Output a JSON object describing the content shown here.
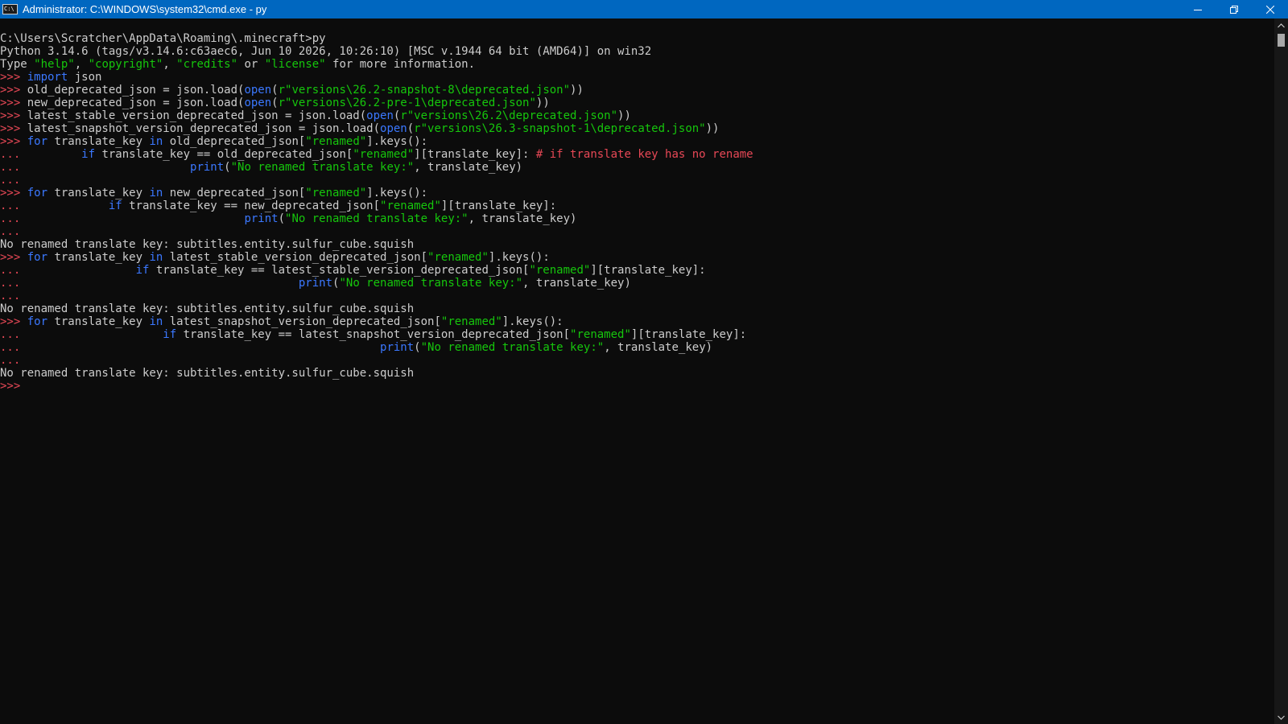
{
  "window": {
    "icon_text": "C:\\",
    "title": "Administrator: C:\\WINDOWS\\system32\\cmd.exe - py",
    "colors": {
      "titlebar": "#0067c0",
      "console_bg": "#0c0c0c",
      "default_text": "#cccccc",
      "prompt": "#e74856",
      "keyword": "#3b78ff",
      "string": "#16c60c",
      "comment": "#e74856"
    },
    "controls": [
      {
        "name": "minimize-button",
        "icon": "minimize-icon"
      },
      {
        "name": "restore-button",
        "icon": "restore-icon"
      },
      {
        "name": "close-button",
        "icon": "close-icon"
      }
    ]
  },
  "console": {
    "lines": [
      [
        {
          "t": "default",
          "s": "C:\\Users\\Scratcher\\AppData\\Roaming\\.minecraft>py"
        }
      ],
      [
        {
          "t": "default",
          "s": "Python 3.14.6 (tags/v3.14.6:c63aec6, Jun 10 2026, 10:26:10) [MSC v.1944 64 bit (AMD64)] on win32"
        }
      ],
      [
        {
          "t": "default",
          "s": "Type "
        },
        {
          "t": "string",
          "s": "\"help\""
        },
        {
          "t": "default",
          "s": ", "
        },
        {
          "t": "string",
          "s": "\"copyright\""
        },
        {
          "t": "default",
          "s": ", "
        },
        {
          "t": "string",
          "s": "\"credits\""
        },
        {
          "t": "default",
          "s": " or "
        },
        {
          "t": "string",
          "s": "\"license\""
        },
        {
          "t": "default",
          "s": " for more information."
        }
      ],
      [
        {
          "t": "prompt",
          "s": ">>> "
        },
        {
          "t": "keyword",
          "s": "import"
        },
        {
          "t": "default",
          "s": " json"
        }
      ],
      [
        {
          "t": "prompt",
          "s": ">>> "
        },
        {
          "t": "default",
          "s": "old_deprecated_json = json.load("
        },
        {
          "t": "keyword",
          "s": "open"
        },
        {
          "t": "default",
          "s": "("
        },
        {
          "t": "string",
          "s": "r\"versions\\26.2-snapshot-8\\deprecated.json\""
        },
        {
          "t": "default",
          "s": "))"
        }
      ],
      [
        {
          "t": "prompt",
          "s": ">>> "
        },
        {
          "t": "default",
          "s": "new_deprecated_json = json.load("
        },
        {
          "t": "keyword",
          "s": "open"
        },
        {
          "t": "default",
          "s": "("
        },
        {
          "t": "string",
          "s": "r\"versions\\26.2-pre-1\\deprecated.json\""
        },
        {
          "t": "default",
          "s": "))"
        }
      ],
      [
        {
          "t": "prompt",
          "s": ">>> "
        },
        {
          "t": "default",
          "s": "latest_stable_version_deprecated_json = json.load("
        },
        {
          "t": "keyword",
          "s": "open"
        },
        {
          "t": "default",
          "s": "("
        },
        {
          "t": "string",
          "s": "r\"versions\\26.2\\deprecated.json\""
        },
        {
          "t": "default",
          "s": "))"
        }
      ],
      [
        {
          "t": "prompt",
          "s": ">>> "
        },
        {
          "t": "default",
          "s": "latest_snapshot_version_deprecated_json = json.load("
        },
        {
          "t": "keyword",
          "s": "open"
        },
        {
          "t": "default",
          "s": "("
        },
        {
          "t": "string",
          "s": "r\"versions\\26.3-snapshot-1\\deprecated.json\""
        },
        {
          "t": "default",
          "s": "))"
        }
      ],
      [
        {
          "t": "prompt",
          "s": ">>> "
        },
        {
          "t": "keyword",
          "s": "for"
        },
        {
          "t": "default",
          "s": " translate_key "
        },
        {
          "t": "keyword",
          "s": "in"
        },
        {
          "t": "default",
          "s": " old_deprecated_json["
        },
        {
          "t": "string",
          "s": "\"renamed\""
        },
        {
          "t": "default",
          "s": "].keys():"
        }
      ],
      [
        {
          "t": "cont",
          "s": "...         "
        },
        {
          "t": "keyword",
          "s": "if"
        },
        {
          "t": "default",
          "s": " translate_key == old_deprecated_json["
        },
        {
          "t": "string",
          "s": "\"renamed\""
        },
        {
          "t": "default",
          "s": "][translate_key]: "
        },
        {
          "t": "comment",
          "s": "# if translate key has no rename"
        }
      ],
      [
        {
          "t": "cont",
          "s": "...                         "
        },
        {
          "t": "keyword",
          "s": "print"
        },
        {
          "t": "default",
          "s": "("
        },
        {
          "t": "string",
          "s": "\"No renamed translate key:\""
        },
        {
          "t": "default",
          "s": ", translate_key)"
        }
      ],
      [
        {
          "t": "cont",
          "s": "..."
        }
      ],
      [
        {
          "t": "prompt",
          "s": ">>> "
        },
        {
          "t": "keyword",
          "s": "for"
        },
        {
          "t": "default",
          "s": " translate_key "
        },
        {
          "t": "keyword",
          "s": "in"
        },
        {
          "t": "default",
          "s": " new_deprecated_json["
        },
        {
          "t": "string",
          "s": "\"renamed\""
        },
        {
          "t": "default",
          "s": "].keys():"
        }
      ],
      [
        {
          "t": "cont",
          "s": "...             "
        },
        {
          "t": "keyword",
          "s": "if"
        },
        {
          "t": "default",
          "s": " translate_key == new_deprecated_json["
        },
        {
          "t": "string",
          "s": "\"renamed\""
        },
        {
          "t": "default",
          "s": "][translate_key]:"
        }
      ],
      [
        {
          "t": "cont",
          "s": "...                                 "
        },
        {
          "t": "keyword",
          "s": "print"
        },
        {
          "t": "default",
          "s": "("
        },
        {
          "t": "string",
          "s": "\"No renamed translate key:\""
        },
        {
          "t": "default",
          "s": ", translate_key)"
        }
      ],
      [
        {
          "t": "cont",
          "s": "..."
        }
      ],
      [
        {
          "t": "default",
          "s": "No renamed translate key: subtitles.entity.sulfur_cube.squish"
        }
      ],
      [
        {
          "t": "prompt",
          "s": ">>> "
        },
        {
          "t": "keyword",
          "s": "for"
        },
        {
          "t": "default",
          "s": " translate_key "
        },
        {
          "t": "keyword",
          "s": "in"
        },
        {
          "t": "default",
          "s": " latest_stable_version_deprecated_json["
        },
        {
          "t": "string",
          "s": "\"renamed\""
        },
        {
          "t": "default",
          "s": "].keys():"
        }
      ],
      [
        {
          "t": "cont",
          "s": "...                 "
        },
        {
          "t": "keyword",
          "s": "if"
        },
        {
          "t": "default",
          "s": " translate_key == latest_stable_version_deprecated_json["
        },
        {
          "t": "string",
          "s": "\"renamed\""
        },
        {
          "t": "default",
          "s": "][translate_key]:"
        }
      ],
      [
        {
          "t": "cont",
          "s": "...                                         "
        },
        {
          "t": "keyword",
          "s": "print"
        },
        {
          "t": "default",
          "s": "("
        },
        {
          "t": "string",
          "s": "\"No renamed translate key:\""
        },
        {
          "t": "default",
          "s": ", translate_key)"
        }
      ],
      [
        {
          "t": "cont",
          "s": "..."
        }
      ],
      [
        {
          "t": "default",
          "s": "No renamed translate key: subtitles.entity.sulfur_cube.squish"
        }
      ],
      [
        {
          "t": "prompt",
          "s": ">>> "
        },
        {
          "t": "keyword",
          "s": "for"
        },
        {
          "t": "default",
          "s": " translate_key "
        },
        {
          "t": "keyword",
          "s": "in"
        },
        {
          "t": "default",
          "s": " latest_snapshot_version_deprecated_json["
        },
        {
          "t": "string",
          "s": "\"renamed\""
        },
        {
          "t": "default",
          "s": "].keys():"
        }
      ],
      [
        {
          "t": "cont",
          "s": "...                     "
        },
        {
          "t": "keyword",
          "s": "if"
        },
        {
          "t": "default",
          "s": " translate_key == latest_snapshot_version_deprecated_json["
        },
        {
          "t": "string",
          "s": "\"renamed\""
        },
        {
          "t": "default",
          "s": "][translate_key]:"
        }
      ],
      [
        {
          "t": "cont",
          "s": "...                                                     "
        },
        {
          "t": "keyword",
          "s": "print"
        },
        {
          "t": "default",
          "s": "("
        },
        {
          "t": "string",
          "s": "\"No renamed translate key:\""
        },
        {
          "t": "default",
          "s": ", translate_key)"
        }
      ],
      [
        {
          "t": "cont",
          "s": "..."
        }
      ],
      [
        {
          "t": "default",
          "s": "No renamed translate key: subtitles.entity.sulfur_cube.squish"
        }
      ],
      [
        {
          "t": "prompt",
          "s": ">>>"
        }
      ]
    ]
  },
  "scrollbar": {
    "up_icon": "chevron-up-icon",
    "down_icon": "chevron-down-icon"
  }
}
